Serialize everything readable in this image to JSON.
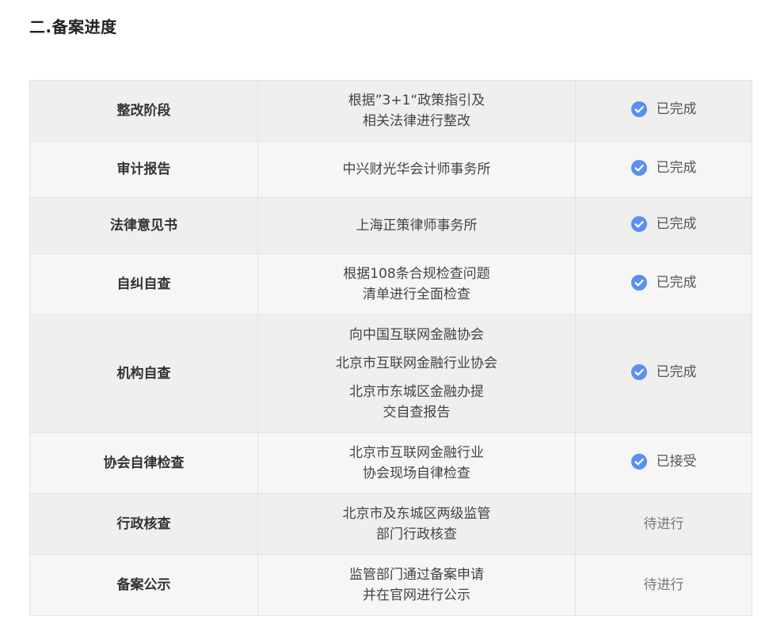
{
  "section_title": "二.备案进度",
  "colors": {
    "check_icon": "#5b8ff0"
  },
  "rows": [
    {
      "stage": "整改阶段",
      "detail": [
        "根据”3+1“政策指引及\n相关法律进行整改"
      ],
      "status": "已完成",
      "done": true
    },
    {
      "stage": "审计报告",
      "detail": [
        "中兴财光华会计师事务所"
      ],
      "status": "已完成",
      "done": true
    },
    {
      "stage": "法律意见书",
      "detail": [
        "上海正策律师事务所"
      ],
      "status": "已完成",
      "done": true
    },
    {
      "stage": "自纠自查",
      "detail": [
        "根据108条合规检查问题\n清单进行全面检查"
      ],
      "status": "已完成",
      "done": true
    },
    {
      "stage": "机构自查",
      "detail": [
        "向中国互联网金融协会",
        "北京市互联网金融行业协会",
        "北京市东城区金融办提\n交自查报告"
      ],
      "status": "已完成",
      "done": true
    },
    {
      "stage": "协会自律检查",
      "detail": [
        "北京市互联网金融行业\n协会现场自律检查"
      ],
      "status": "已接受",
      "done": true
    },
    {
      "stage": "行政核查",
      "detail": [
        "北京市及东城区两级监管\n部门行政核查"
      ],
      "status": "待进行",
      "done": false
    },
    {
      "stage": "备案公示",
      "detail": [
        "监管部门通过备案申请\n并在官网进行公示"
      ],
      "status": "待进行",
      "done": false
    }
  ]
}
